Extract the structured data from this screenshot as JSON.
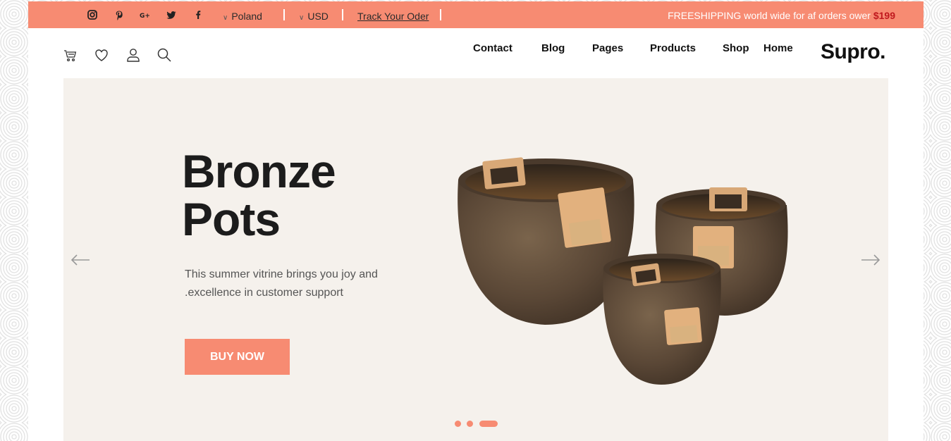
{
  "topbar": {
    "social": [
      {
        "icon": "instagram-icon"
      },
      {
        "icon": "pinterest-icon"
      },
      {
        "icon": "google-plus-icon"
      },
      {
        "icon": "twitter-icon"
      },
      {
        "icon": "facebook-icon"
      }
    ],
    "country": "Poland",
    "currency": "USD",
    "track_label": "Track Your Oder",
    "promo_text": "FREESHIPPING world wide for af orders ower ",
    "promo_price": "$199"
  },
  "header": {
    "icons": [
      "cart-icon",
      "heart-icon",
      "user-icon",
      "search-icon"
    ],
    "nav": {
      "contact": "Contact",
      "blog": "Blog",
      "pages": "Pages",
      "products": "Products",
      "shop": "Shop",
      "home": "Home"
    },
    "logo": "Supro."
  },
  "hero": {
    "title_line1": "Bronze",
    "title_line2": "Pots",
    "subtitle_line1": "This summer vitrine brings you joy and",
    "subtitle_line2": ".excellence in customer support",
    "button_label": "BUY NOW",
    "slide_count": 3,
    "active_slide": 3
  },
  "colors": {
    "accent": "#f78b72",
    "hero_bg": "#f5f1ec",
    "price": "#c0191e"
  }
}
